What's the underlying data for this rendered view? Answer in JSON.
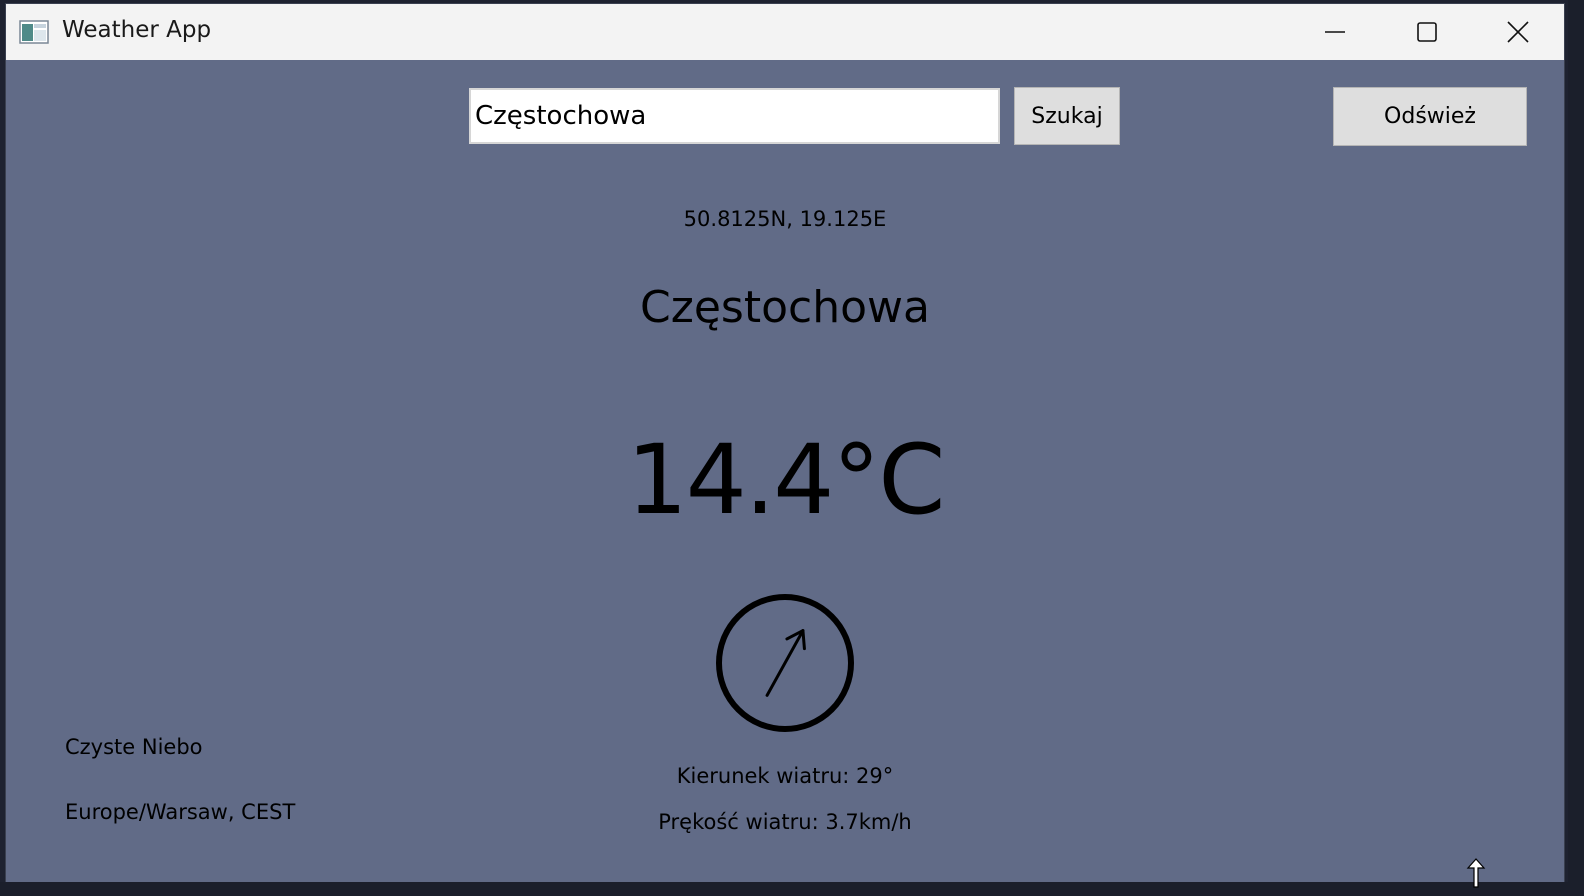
{
  "window": {
    "title": "Weather App",
    "icon": "app-window-icon",
    "controls": [
      "minimize-icon",
      "maximize-icon",
      "close-icon"
    ]
  },
  "search": {
    "value": "Częstochowa",
    "button_label": "Szukaj"
  },
  "refresh": {
    "label": "Odśwież"
  },
  "location": {
    "coordinates": "50.8125N, 19.125E",
    "city": "Częstochowa"
  },
  "weather": {
    "temperature": "14.4°C",
    "condition": "Czyste Niebo",
    "timezone": "Europe/Warsaw, CEST"
  },
  "wind": {
    "direction_label": "Kierunek wiatru: 29°",
    "direction_degrees": 29,
    "speed_label": "Prękość wiatru: 3.7km/h"
  },
  "colors": {
    "background": "#616b87",
    "titlebar": "#f3f3f3",
    "button": "#dedede"
  }
}
